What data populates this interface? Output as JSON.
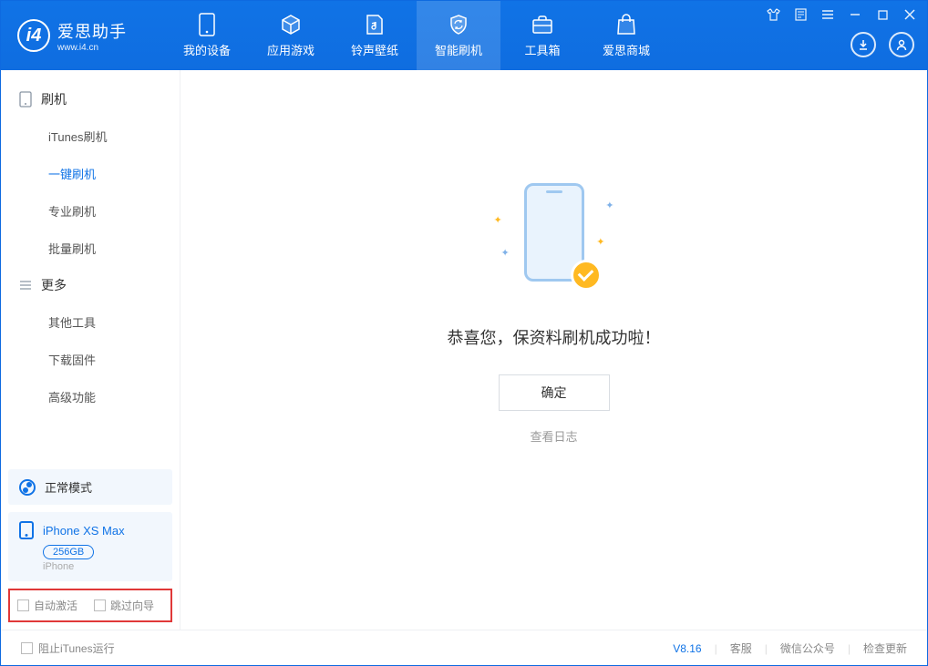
{
  "app": {
    "name": "爱思助手",
    "url": "www.i4.cn"
  },
  "tabs": [
    {
      "label": "我的设备"
    },
    {
      "label": "应用游戏"
    },
    {
      "label": "铃声壁纸"
    },
    {
      "label": "智能刷机"
    },
    {
      "label": "工具箱"
    },
    {
      "label": "爱思商城"
    }
  ],
  "sidebar": {
    "group1": "刷机",
    "items1": [
      "iTunes刷机",
      "一键刷机",
      "专业刷机",
      "批量刷机"
    ],
    "group2": "更多",
    "items2": [
      "其他工具",
      "下载固件",
      "高级功能"
    ]
  },
  "mode": {
    "label": "正常模式"
  },
  "device": {
    "name": "iPhone XS Max",
    "capacity": "256GB",
    "type": "iPhone"
  },
  "checks": {
    "auto": "自动激活",
    "skip": "跳过向导"
  },
  "main": {
    "msg": "恭喜您，保资料刷机成功啦！",
    "ok": "确定",
    "log": "查看日志"
  },
  "footer": {
    "block": "阻止iTunes运行",
    "version": "V8.16",
    "support": "客服",
    "wechat": "微信公众号",
    "update": "检查更新"
  }
}
